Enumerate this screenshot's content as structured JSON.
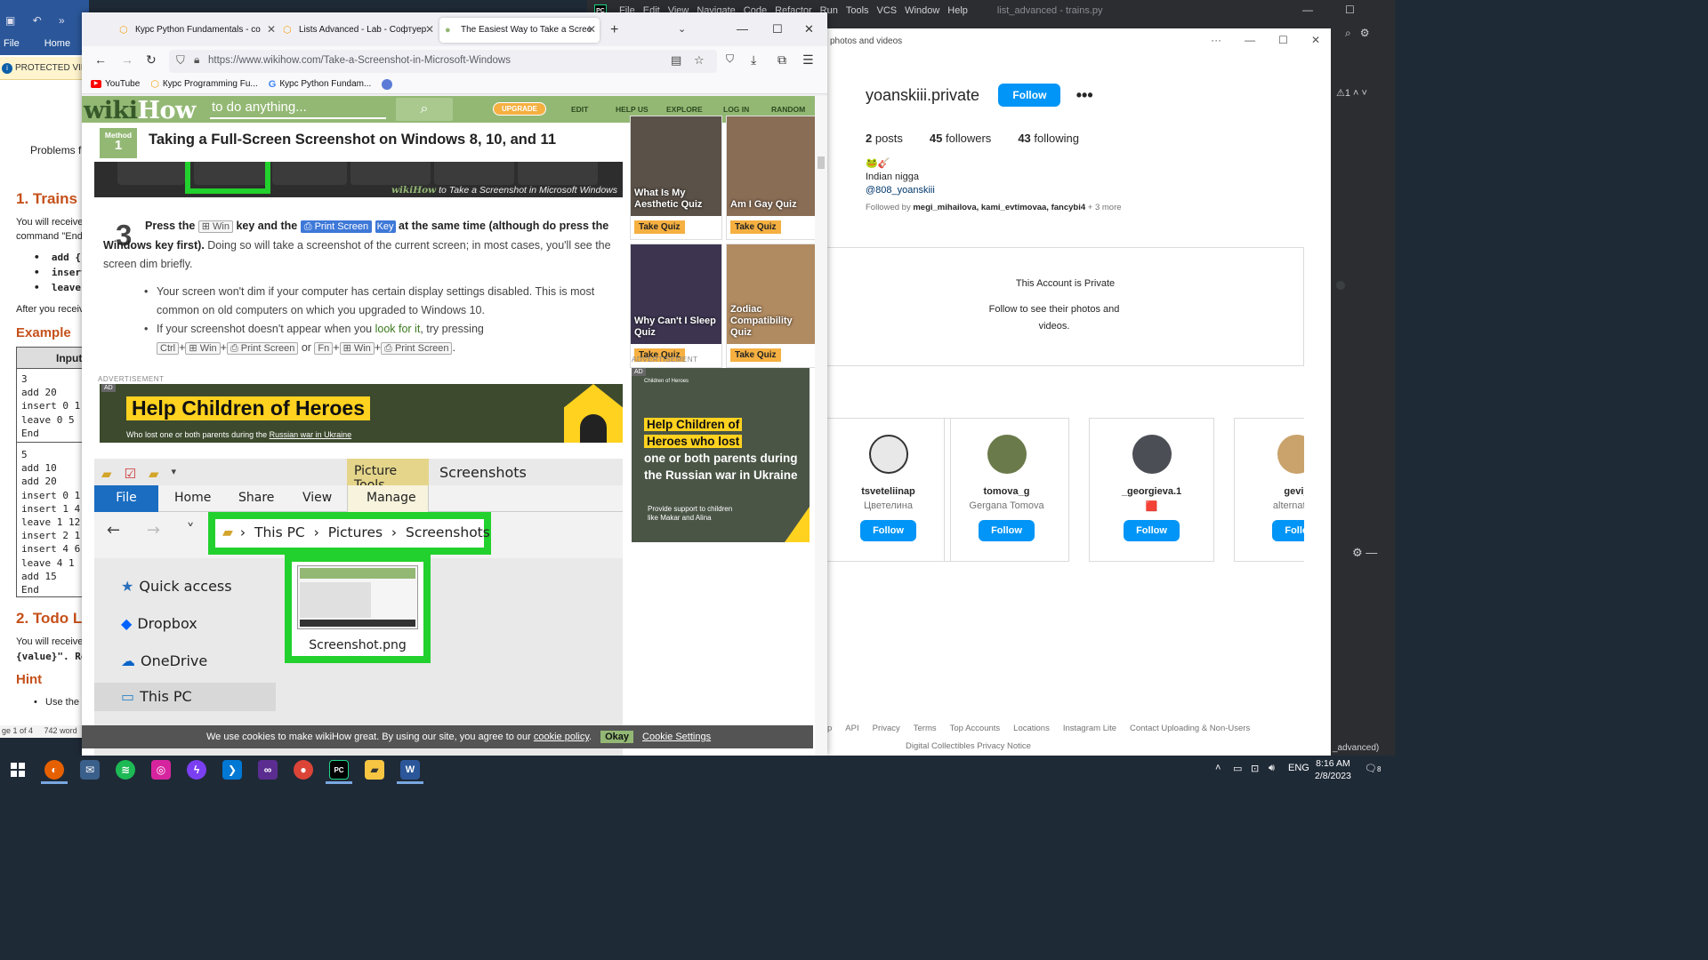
{
  "pycharm": {
    "logo": "PC",
    "menu": [
      "File",
      "Edit",
      "View",
      "Navigate",
      "Code",
      "Refactor",
      "Run",
      "Tools",
      "VCS",
      "Window",
      "Help"
    ],
    "project_title": "list_advanced - trains.py",
    "warning_count": "1",
    "bottom_text": "_advanced)"
  },
  "word": {
    "tabs": [
      "File",
      "Home"
    ],
    "protected_view": "PROTECTED VIEW",
    "problems_text": "Problems fo",
    "heading1": "1. Trains",
    "line_receive": "You will receive",
    "line_command": "command \"End",
    "bullets": [
      "add {",
      "insert",
      "leave"
    ],
    "after_you": "After you receiv",
    "example": "Example",
    "table_header": "Input",
    "table_block1": "3\nadd 20\ninsert 0 1\nleave 0 5\nEnd",
    "table_block2": "5\nadd 10\nadd 20\ninsert 0 1\ninsert 1 4\nleave 1 12\ninsert 2 1\ninsert 4 6\nleave 4 1\nadd 15\nEnd",
    "heading2": "2. Todo L",
    "receive2": "You will receive",
    "value_text": "{value}\". Ret",
    "hint": "Hint",
    "use_the": "Use the",
    "status_page": "ge 1 of 4",
    "status_words": "742 word"
  },
  "firefox": {
    "tabs": [
      {
        "title": "Курс Python Fundamentals - co",
        "active": false
      },
      {
        "title": "Lists Advanced - Lab - Софтуер",
        "active": false
      },
      {
        "title": "The Easiest Way to Take a Scree",
        "active": true
      }
    ],
    "url": "https://www.wikihow.com/Take-a-Screenshot-in-Microsoft-Windows",
    "bookmarks": [
      "YouTube",
      "Курс Programming Fu...",
      "Курс Python Fundam..."
    ]
  },
  "wikihow": {
    "logo_wiki": "wiki",
    "logo_how": "How",
    "search_placeholder": "to do anything...",
    "upgrade": "UPGRADE",
    "nav": [
      "EDIT",
      "HELP US",
      "EXPLORE",
      "LOG IN",
      "RANDOM"
    ],
    "method_label": "Method",
    "method_number": "1",
    "method_title": "Taking a Full-Screen Screenshot on Windows 8, 10, and 11",
    "image_caption_brand": "wikiHow",
    "image_caption": " to Take a Screenshot in Microsoft Windows",
    "step_number": "3",
    "step_press": "Press the ",
    "key_win": "⊞ Win",
    "step_and": " key and the ",
    "key_print": "⎙ Print Screen",
    "key_key": "Key",
    "step_bold_rest": " at the same time (although do press the Windows key first).",
    "step_plain": " Doing so will take a screenshot of the current screen; in most cases, you'll see the screen dim briefly.",
    "bullet1": "Your screen won't dim if your computer has certain display settings disabled. This is most common on old computers on which you upgraded to Windows 10.",
    "bullet2_a": "If your screenshot doesn't appear when you ",
    "bullet2_link": "look for it",
    "bullet2_b": ", try pressing ",
    "key_ctrl": "Ctrl",
    "key_win2": "⊞ Win",
    "key_ps2": "⎙ Print Screen",
    "or": " or ",
    "key_fn": "Fn",
    "key_win3": "⊞ Win",
    "key_ps3": "⎙ Print Screen",
    "period": ".",
    "ad_label": "ADVERTISEMENT",
    "ad_tag": "AD",
    "ad_headline": "Help Children of Heroes",
    "ad_sub_a": "Who lost one or both parents during the ",
    "ad_sub_b": "Russian war in Ukraine",
    "explorer": {
      "picture_tools": "Picture Tools",
      "screenshots_title": "Screenshots",
      "ribbon": [
        "File",
        "Home",
        "Share",
        "View",
        "Manage"
      ],
      "path": [
        "This PC",
        "Pictures",
        "Screenshots"
      ],
      "nav": [
        "Quick access",
        "Dropbox",
        "OneDrive",
        "This PC"
      ],
      "file_name": "Screenshot.png"
    },
    "quizzes": [
      {
        "title": "What Is My Aesthetic Quiz",
        "button": "Take Quiz"
      },
      {
        "title": "Am I Gay Quiz",
        "button": "Take Quiz"
      },
      {
        "title": "Why Can't I Sleep Quiz",
        "button": "Take Quiz"
      },
      {
        "title": "Zodiac Compatibility Quiz",
        "button": "Take Quiz"
      }
    ],
    "side_ad_label": "ADVERTISEMENT",
    "side_ad_org": "Children of Heroes",
    "side_ad_h1": "Help Children of",
    "side_ad_h2": "Heroes who lost",
    "side_ad_h3": "one or both parents during the Russian war in Ukraine",
    "side_ad_sub1": "Provide support to children",
    "side_ad_sub2": "like Makar and Alina",
    "cookie_text": "We use cookies to make wikiHow great. By using our site, you agree to our ",
    "cookie_link": "cookie policy",
    "cookie_ok": "Okay",
    "cookie_settings": "Cookie Settings"
  },
  "instagram": {
    "header_text": "photos and videos",
    "username": "yoanskiii.private",
    "follow": "Follow",
    "more": "•••",
    "posts": "2",
    "posts_label": " posts",
    "followers": "45",
    "followers_label": " followers",
    "following": "43",
    "following_label": " following",
    "bio_emoji": "🐸🎸",
    "bio_line": "Indian nigga",
    "bio_handle": "@808_yoanskiii",
    "followed_by_prefix": "Followed by ",
    "followed_by_names": "megi_mihailova, kami_evtimovaa, fancybi4",
    "followed_by_more": " + 3 more",
    "private_title": "This Account is Private",
    "private_sub": "Follow to see their photos and videos.",
    "suggestions": [
      {
        "name": "tsveteliinap",
        "real": "Цветелина",
        "button": "Follow"
      },
      {
        "name": "tomova_g",
        "real": "Gergana Tomova",
        "button": "Follow"
      },
      {
        "name": "_georgieva.1",
        "real": "🟥",
        "button": "Follow"
      },
      {
        "name": "gevi_",
        "real": "alternativni",
        "button": "Follo"
      }
    ],
    "footer_row1": [
      "p",
      "API",
      "Privacy",
      "Terms",
      "Top Accounts",
      "Locations",
      "Instagram Lite",
      "Contact Uploading & Non-Users"
    ],
    "footer_row2": "Digital Collectibles Privacy Notice"
  },
  "taskbar": {
    "lang": "ENG",
    "time": "8:16 AM",
    "date": "2/8/2023",
    "notif": "8"
  },
  "colors": {
    "wikihow_green": "#93b874",
    "instagram_blue": "#0095f6",
    "word_blue": "#2b579a",
    "highlight_green": "#22d12d",
    "ad_yellow": "#ffd21f"
  }
}
